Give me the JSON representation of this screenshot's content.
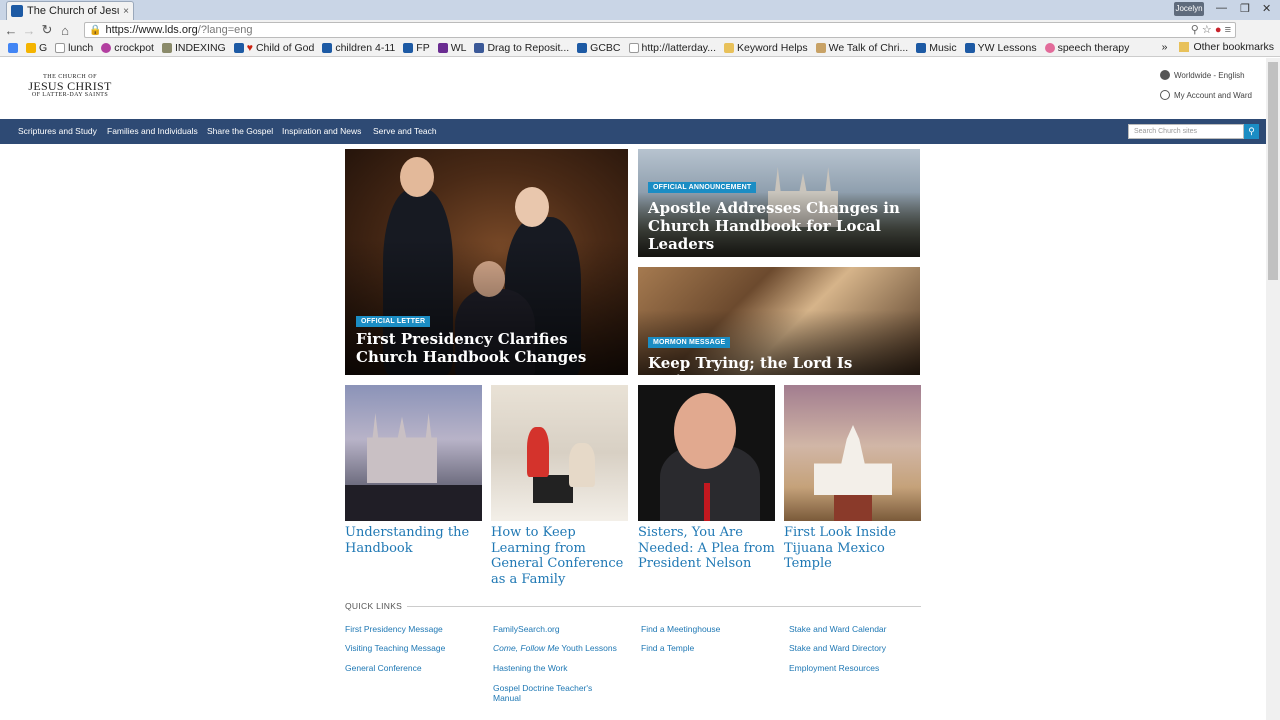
{
  "browser": {
    "tab_title": "The Church of Jesus",
    "tab_close": "×",
    "profile": "Jocelyn",
    "url_host": "https://www.lds.org",
    "url_path": "/?lang=eng",
    "bookmarks": [
      "G",
      "lunch",
      "crockpot",
      "INDEXING",
      "Child of God",
      "children 4-11",
      "FP",
      "WL",
      "Drag to Reposit...",
      "GCBC",
      "http://latterday...",
      "Keyword Helps",
      "We Talk of Chri...",
      "Music",
      "YW Lessons",
      "speech therapy"
    ],
    "bookmarks_more": "»",
    "other_bookmarks": "Other bookmarks"
  },
  "header": {
    "logo_line1": "THE CHURCH OF",
    "logo_line2": "JESUS CHRIST",
    "logo_line3": "OF LATTER-DAY SAINTS",
    "worldwide": "Worldwide - English",
    "account": "My Account and Ward"
  },
  "nav": {
    "items": [
      "Scriptures and Study",
      "Families and Individuals",
      "Share the Gospel",
      "Inspiration and News",
      "Serve and Teach"
    ],
    "search_placeholder": "Search Church sites"
  },
  "features": {
    "main": {
      "tag": "OFFICIAL LETTER",
      "title": "First Presidency Clarifies Church Handbook Changes"
    },
    "a": {
      "tag": "OFFICIAL ANNOUNCEMENT",
      "title": "Apostle Addresses Changes in Church Handbook for Local Leaders"
    },
    "b": {
      "tag": "MORMON MESSAGE",
      "title": "Keep Trying; the Lord Is Patient"
    }
  },
  "thumbs": [
    {
      "title": "Understanding the Handbook"
    },
    {
      "title": "How to Keep Learning from General Conference as a Family"
    },
    {
      "title": "Sisters, You Are Needed: A Plea from President Nelson"
    },
    {
      "title": "First Look Inside Tijuana Mexico Temple"
    }
  ],
  "quick_links": {
    "label": "QUICK LINKS",
    "col1": [
      "First Presidency Message",
      "Visiting Teaching Message",
      "General Conference"
    ],
    "col2": [
      "FamilySearch.org",
      "Come, Follow Me",
      "Youth Lessons",
      "Hastening the Work",
      "Gospel Doctrine Teacher's",
      "Manual"
    ],
    "col3": [
      "Find a Meetinghouse",
      "Find a Temple"
    ],
    "col4": [
      "Stake and Ward Calendar",
      "Stake and Ward Directory",
      "Employment Resources"
    ]
  },
  "colors": {
    "nav_bg": "#2e4a74",
    "accent": "#1b8dc4",
    "link": "#1f78b4"
  }
}
